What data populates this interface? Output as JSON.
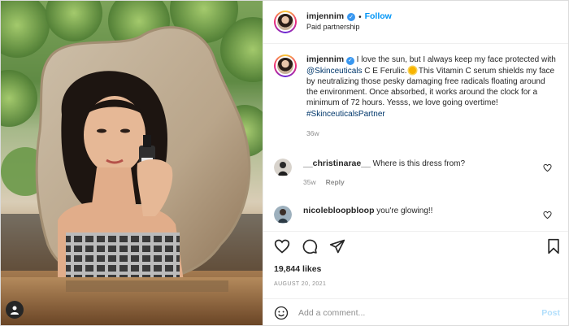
{
  "header": {
    "username": "imjennim",
    "separator": "•",
    "follow_label": "Follow",
    "subtitle": "Paid partnership"
  },
  "caption": {
    "username": "imjennim",
    "text_1": "I love the sun, but I always keep my face protected with",
    "mention": "@Skinceuticals",
    "text_2": "C E Ferulic.",
    "text_3": "This Vitamin C serum shields my face by neutralizing those pesky damaging free radicals floating around the environment. Once absorbed, it works around the clock for a minimum of 72 hours. Yesss, we love going overtime!",
    "hashtag": "#SkinceuticalsPartner",
    "age": "36w"
  },
  "comments": [
    {
      "username": "__christinarae__",
      "text": "Where is this dress from?",
      "age": "35w",
      "reply_label": "Reply"
    },
    {
      "username": "nicolebloopbloop",
      "text": "you're glowing!!"
    }
  ],
  "actions": {
    "likes": "19,844 likes",
    "date": "AUGUST 20, 2021"
  },
  "add_comment": {
    "placeholder": "Add a comment...",
    "post_label": "Post"
  },
  "icons": [
    "heart-icon",
    "comment-icon",
    "share-icon",
    "bookmark-icon",
    "emoji-icon",
    "user-tag-icon",
    "verified-icon",
    "sun-emoji-icon"
  ],
  "colors": {
    "link": "#00376b",
    "follow": "#0095f6",
    "verified": "#3897f0",
    "post_disabled": "#b2dffc",
    "meta": "#8e8e8e"
  }
}
